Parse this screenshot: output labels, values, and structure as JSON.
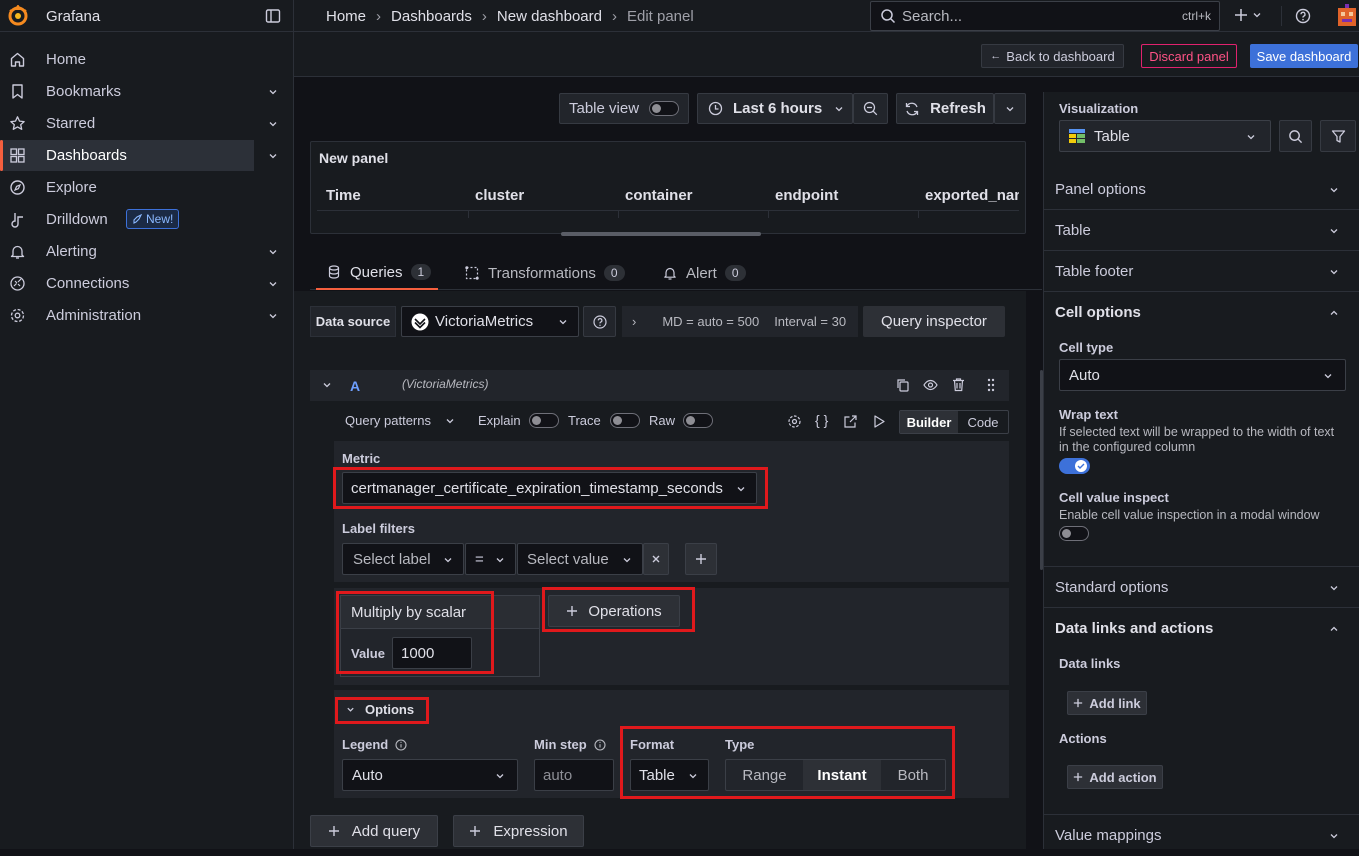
{
  "app": {
    "title": "Grafana"
  },
  "breadcrumb": [
    "Home",
    "Dashboards",
    "New dashboard",
    "Edit panel"
  ],
  "search": {
    "placeholder": "Search...",
    "shortcut": "ctrl+k"
  },
  "sidebar": {
    "items": [
      {
        "label": "Home",
        "icon": "home-icon",
        "chevron": false
      },
      {
        "label": "Bookmarks",
        "icon": "bookmark-icon",
        "chevron": true
      },
      {
        "label": "Starred",
        "icon": "star-icon",
        "chevron": true
      },
      {
        "label": "Dashboards",
        "icon": "apps-icon",
        "chevron": true,
        "active": true
      },
      {
        "label": "Explore",
        "icon": "compass-icon",
        "chevron": false
      },
      {
        "label": "Drilldown",
        "icon": "drilldown-icon",
        "chevron": false,
        "badge": "New!"
      },
      {
        "label": "Alerting",
        "icon": "bell-icon",
        "chevron": true
      },
      {
        "label": "Connections",
        "icon": "connections-icon",
        "chevron": true
      },
      {
        "label": "Administration",
        "icon": "gear-icon",
        "chevron": true
      }
    ]
  },
  "toolbar": {
    "back": "Back to dashboard",
    "discard": "Discard panel",
    "save": "Save dashboard",
    "table_view": "Table view",
    "time_range": "Last 6 hours",
    "refresh": "Refresh"
  },
  "panel": {
    "title": "New panel",
    "columns": [
      "Time",
      "cluster",
      "container",
      "endpoint",
      "exported_nan"
    ]
  },
  "tabs": [
    {
      "label": "Queries",
      "count": "1"
    },
    {
      "label": "Transformations",
      "count": "0"
    },
    {
      "label": "Alert",
      "count": "0"
    }
  ],
  "datasource": {
    "label": "Data source",
    "name": "VictoriaMetrics",
    "info": "MD = auto = 500",
    "interval": "Interval = 30",
    "inspector": "Query inspector"
  },
  "query": {
    "ref": "A",
    "ds": "(VictoriaMetrics)",
    "patterns": "Query patterns",
    "explain": "Explain",
    "trace": "Trace",
    "raw": "Raw",
    "builder": "Builder",
    "code": "Code",
    "metric_label": "Metric",
    "metric": "certmanager_certificate_expiration_timestamp_seconds",
    "label_filters": "Label filters",
    "select_label": "Select label",
    "op": "=",
    "select_value": "Select value",
    "op_name": "Multiply by scalar",
    "value_label": "Value",
    "value": "1000",
    "operations": "Operations",
    "options": "Options",
    "legend_label": "Legend",
    "legend": "Auto",
    "min_step_label": "Min step",
    "min_step_placeholder": "auto",
    "format_label": "Format",
    "format": "Table",
    "type_label": "Type",
    "types": [
      "Range",
      "Instant",
      "Both"
    ],
    "type_selected": "Instant",
    "add_query": "Add query",
    "expression": "Expression"
  },
  "options_pane": {
    "viz_label": "Visualization",
    "viz": "Table",
    "sections": {
      "panel_options": "Panel options",
      "table": "Table",
      "table_footer": "Table footer",
      "cell_options": "Cell options",
      "standard_options": "Standard options",
      "data_links": "Data links and actions",
      "value_mappings": "Value mappings"
    },
    "cell_type_label": "Cell type",
    "cell_type": "Auto",
    "wrap_text": "Wrap text",
    "wrap_text_desc": "If selected text will be wrapped to the width of text in the configured column",
    "cell_value_inspect": "Cell value inspect",
    "cell_value_inspect_desc": "Enable cell value inspection in a modal window",
    "data_links_label": "Data links",
    "add_link": "Add link",
    "actions_label": "Actions",
    "add_action": "Add action"
  },
  "colors": {
    "accent": "#3d71d9",
    "danger": "#e0226e",
    "orange": "#f55f3e"
  }
}
